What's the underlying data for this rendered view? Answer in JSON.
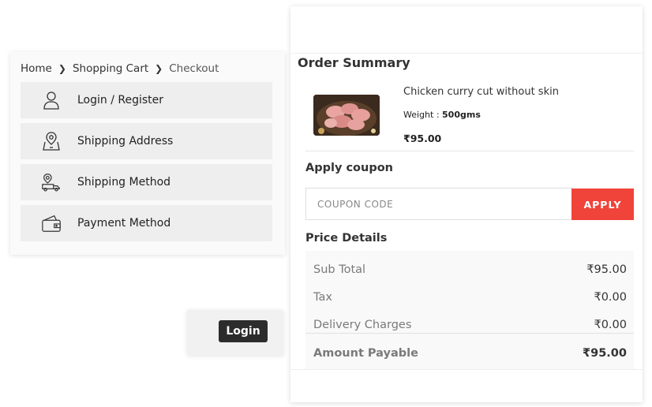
{
  "breadcrumb": {
    "home": "Home",
    "cart": "Shopping Cart",
    "checkout": "Checkout"
  },
  "steps": [
    {
      "label": "Login / Register",
      "icon": "user-icon"
    },
    {
      "label": "Shipping Address",
      "icon": "location-pin-icon"
    },
    {
      "label": "Shipping Method",
      "icon": "delivery-truck-icon"
    },
    {
      "label": "Payment Method",
      "icon": "wallet-icon"
    }
  ],
  "login_button": "Login",
  "summary": {
    "title": "Order Summary",
    "product": {
      "name": "Chicken curry cut without skin",
      "weight_label": "Weight : ",
      "weight_value": "500gms",
      "price": "₹95.00"
    },
    "coupon": {
      "title": "Apply coupon",
      "placeholder": "COUPON CODE",
      "apply_label": "APPLY"
    },
    "price_details": {
      "title": "Price Details",
      "rows": [
        {
          "label": "Sub Total",
          "value": "₹95.00"
        },
        {
          "label": "Tax",
          "value": "₹0.00"
        },
        {
          "label": "Delivery Charges",
          "value": "₹0.00"
        },
        {
          "label": "Amount Payable",
          "value": "₹95.00"
        }
      ]
    }
  },
  "colors": {
    "apply_button": "#f0443a",
    "login_button": "#2c2c2c",
    "step_background": "#eeeeee"
  }
}
